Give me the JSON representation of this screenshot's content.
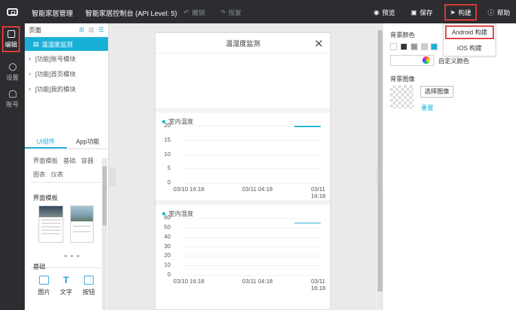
{
  "topbar": {
    "app_title": "智能家居管理",
    "console_title": "智能家居控制台 (API Level: 5)",
    "undo": "撤销",
    "redo": "恢复",
    "preview": "预览",
    "save": "保存",
    "build": "构建",
    "help": "帮助"
  },
  "leftnav": [
    {
      "label": "编辑",
      "icon": "edit-icon"
    },
    {
      "label": "设置",
      "icon": "settings-icon"
    },
    {
      "label": "账号",
      "icon": "account-icon"
    }
  ],
  "pages": {
    "header": "页面",
    "items": [
      "温湿度监测",
      "[功能]账号模块",
      "[功能]首页模块",
      "[功能]我的模块"
    ]
  },
  "component_tabs": [
    "UI组件",
    "App功能"
  ],
  "categories_row1": [
    "界面模板",
    "基础",
    "容器"
  ],
  "categories_row2": [
    "图表",
    "仪表"
  ],
  "section_templates": "界面模板",
  "section_basic": "基础",
  "basic_items": [
    {
      "label": "图片",
      "icon": "image-icon"
    },
    {
      "label": "文字",
      "icon": "text-icon"
    },
    {
      "label": "按钮",
      "icon": "button-icon"
    }
  ],
  "phone": {
    "title": "温湿度监测"
  },
  "chart_data": [
    {
      "type": "line",
      "title": "室内温度",
      "x": [
        "03/10 16:18",
        "03/11 04:18",
        "03/11 16:18"
      ],
      "yticks": [
        0,
        5,
        10,
        15,
        20
      ],
      "ylim": [
        0,
        20
      ],
      "series": [
        {
          "values": [
            {
              "x": "03/11 16:18",
              "y": 20
            }
          ]
        }
      ],
      "grid": true
    },
    {
      "type": "line",
      "title": "室内湿度",
      "x": [
        "03/10 16:18",
        "03/11 04:18",
        "03/11 16:18"
      ],
      "yticks": [
        0,
        10,
        20,
        30,
        40,
        50,
        60
      ],
      "ylim": [
        0,
        60
      ],
      "series": [
        {
          "values": [
            {
              "x": "03/11 16:18",
              "y": 55
            }
          ]
        }
      ],
      "grid": true
    }
  ],
  "props": {
    "bg_color_label": "背景颜色",
    "custom_color": "自定义颜色",
    "bg_image_label": "背景图像",
    "choose_image": "选择图像",
    "reset": "重置",
    "swatches": [
      "#ffffff",
      "#333333",
      "#999999",
      "#cccccc",
      "#19b0d8"
    ]
  },
  "build_menu": {
    "android": "Android 构建",
    "ios": "iOS 构建"
  },
  "colors": {
    "accent": "#19b0d8",
    "highlight": "#e23b3b",
    "topbar": "#2b2d30"
  }
}
